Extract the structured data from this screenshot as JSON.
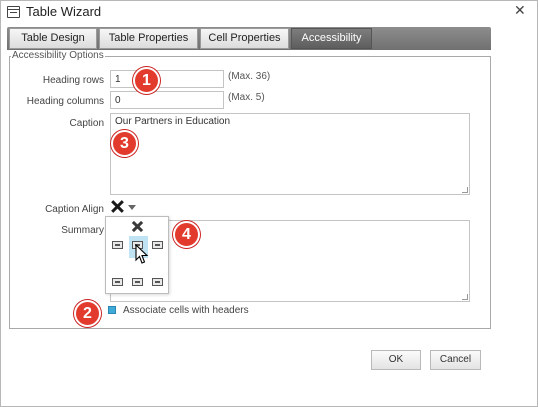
{
  "window": {
    "title": "Table Wizard",
    "close_glyph": "✕"
  },
  "tabs": [
    {
      "label": "Table Design",
      "active": false
    },
    {
      "label": "Table Properties",
      "active": false
    },
    {
      "label": "Cell Properties",
      "active": false
    },
    {
      "label": "Accessibility",
      "active": true
    }
  ],
  "accessibility": {
    "legend": "Accessibility Options",
    "heading_rows": {
      "label": "Heading rows",
      "value": "1",
      "max": "(Max. 36)"
    },
    "heading_columns": {
      "label": "Heading columns",
      "value": "0",
      "max": "(Max. 5)"
    },
    "caption": {
      "label": "Caption",
      "value": "Our Partners in Education"
    },
    "caption_align": {
      "label": "Caption Align",
      "icon": "x-icon",
      "dropdown_icon": "dropdown-arrow-icon"
    },
    "summary": {
      "label": "Summary",
      "value": ""
    },
    "align_popup": {
      "options": [
        "none",
        "top-left",
        "top-center",
        "top-right",
        "bottom-left",
        "bottom-center",
        "bottom-right"
      ],
      "selected": "top-center"
    },
    "associate_cells": {
      "label": "Associate cells with headers",
      "checked": true
    }
  },
  "buttons": {
    "ok": "OK",
    "cancel": "Cancel"
  },
  "annotations": [
    "1",
    "2",
    "3",
    "4"
  ],
  "colors": {
    "active_tab": "#666666",
    "badge": "#e23b2e",
    "checkbox": "#3fa9d8",
    "selection": "#bfe3f3"
  }
}
